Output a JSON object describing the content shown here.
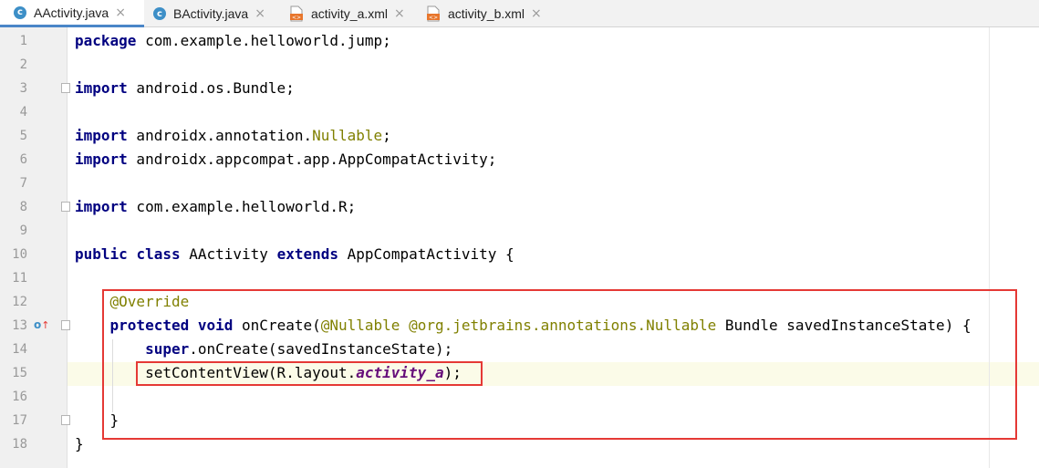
{
  "tabs": [
    {
      "label": "AActivity.java",
      "icon": "java-class-icon",
      "active": true
    },
    {
      "label": "BActivity.java",
      "icon": "java-class-icon",
      "active": false
    },
    {
      "label": "activity_a.xml",
      "icon": "xml-file-icon",
      "active": false
    },
    {
      "label": "activity_b.xml",
      "icon": "xml-file-icon",
      "active": false
    }
  ],
  "editor": {
    "current_line": 15,
    "lines": [
      {
        "num": "1",
        "tokens": [
          {
            "t": "package",
            "c": "kw"
          },
          {
            "t": " com.example.helloworld.jump;"
          }
        ]
      },
      {
        "num": "2",
        "tokens": []
      },
      {
        "num": "3",
        "tokens": [
          {
            "t": "import",
            "c": "kw"
          },
          {
            "t": " android.os.Bundle;"
          }
        ]
      },
      {
        "num": "4",
        "tokens": []
      },
      {
        "num": "5",
        "tokens": [
          {
            "t": "import",
            "c": "kw"
          },
          {
            "t": " androidx.annotation."
          },
          {
            "t": "Nullable",
            "c": "ann"
          },
          {
            "t": ";"
          }
        ]
      },
      {
        "num": "6",
        "tokens": [
          {
            "t": "import",
            "c": "kw"
          },
          {
            "t": " androidx.appcompat.app.AppCompatActivity;"
          }
        ]
      },
      {
        "num": "7",
        "tokens": []
      },
      {
        "num": "8",
        "tokens": [
          {
            "t": "import",
            "c": "kw"
          },
          {
            "t": " com.example.helloworld.R;"
          }
        ]
      },
      {
        "num": "9",
        "tokens": []
      },
      {
        "num": "10",
        "tokens": [
          {
            "t": "public",
            "c": "kw"
          },
          {
            "t": " "
          },
          {
            "t": "class",
            "c": "kw"
          },
          {
            "t": " AActivity "
          },
          {
            "t": "extends",
            "c": "kw"
          },
          {
            "t": " AppCompatActivity {"
          }
        ]
      },
      {
        "num": "11",
        "tokens": []
      },
      {
        "num": "12",
        "tokens": [
          {
            "t": "    "
          },
          {
            "t": "@Override",
            "c": "ann"
          }
        ]
      },
      {
        "num": "13",
        "tokens": [
          {
            "t": "    "
          },
          {
            "t": "protected",
            "c": "kw"
          },
          {
            "t": " "
          },
          {
            "t": "void",
            "c": "kw"
          },
          {
            "t": " onCreate("
          },
          {
            "t": "@Nullable",
            "c": "ann"
          },
          {
            "t": " "
          },
          {
            "t": "@org.jetbrains.annotations.",
            "c": "ann"
          },
          {
            "t": "Nullable",
            "c": "ann"
          },
          {
            "t": " Bundle savedInstanceState) {"
          }
        ]
      },
      {
        "num": "14",
        "tokens": [
          {
            "t": "        "
          },
          {
            "t": "super",
            "c": "kw"
          },
          {
            "t": ".onCreate(savedInstanceState);"
          }
        ]
      },
      {
        "num": "15",
        "tokens": [
          {
            "t": "        setContentView(R.layout."
          },
          {
            "t": "activity_a",
            "c": "it"
          },
          {
            "t": ");"
          }
        ]
      },
      {
        "num": "16",
        "tokens": []
      },
      {
        "num": "17",
        "tokens": [
          {
            "t": "    }"
          }
        ]
      },
      {
        "num": "18",
        "tokens": [
          {
            "t": "}"
          }
        ]
      }
    ]
  },
  "gutter_icons": [
    {
      "line": "13",
      "name": "override-method-icon",
      "glyph_o": "o",
      "glyph_arrow": "↑"
    }
  ],
  "colors": {
    "keyword": "#000080",
    "annotation": "#808000",
    "field_italic": "#660e7a",
    "highlight_box": "#e53935",
    "current_line": "#fbfbe8"
  }
}
